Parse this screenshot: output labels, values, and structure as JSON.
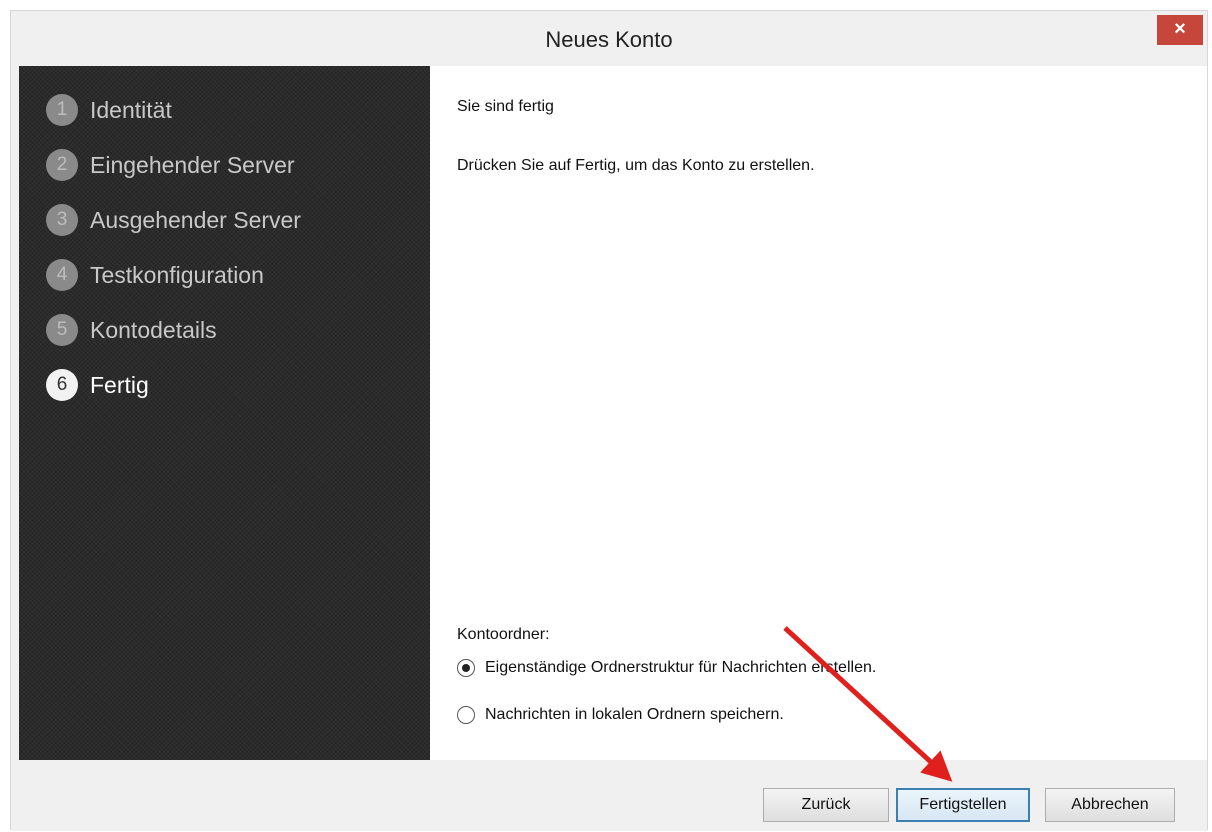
{
  "window": {
    "title": "Neues Konto",
    "close_glyph": "×"
  },
  "steps": [
    {
      "num": "1",
      "label": "Identität",
      "active": false
    },
    {
      "num": "2",
      "label": "Eingehender Server",
      "active": false
    },
    {
      "num": "3",
      "label": "Ausgehender Server",
      "active": false
    },
    {
      "num": "4",
      "label": "Testkonfiguration",
      "active": false
    },
    {
      "num": "5",
      "label": "Kontodetails",
      "active": false
    },
    {
      "num": "6",
      "label": "Fertig",
      "active": true
    }
  ],
  "content": {
    "heading": "Sie sind fertig",
    "description": "Drücken Sie auf Fertig, um das Konto zu erstellen.",
    "folder_label": "Kontoordner:",
    "options": [
      {
        "label": "Eigenständige Ordnerstruktur für Nachrichten erstellen.",
        "checked": true
      },
      {
        "label": "Nachrichten in lokalen Ordnern speichern.",
        "checked": false
      }
    ]
  },
  "buttons": {
    "back": "Zurück",
    "finish": "Fertigstellen",
    "cancel": "Abbrechen"
  },
  "colors": {
    "close_button": "#c7463c",
    "sidebar_bg": "#2b2b2b",
    "annotation_arrow": "#e0201c",
    "default_button_border": "#3c7fb1"
  }
}
